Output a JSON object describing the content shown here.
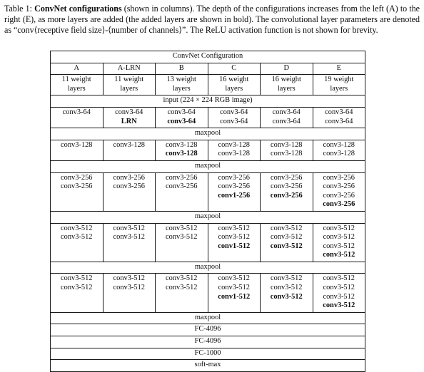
{
  "caption": {
    "label": "Table 1:",
    "bold_title": "ConvNet configurations",
    "text_rest": " (shown in columns). The depth of the configurations increases from the left (A) to the right (E), as more layers are added (the added layers are shown in bold). The convolutional layer parameters are denoted as “conv⟨receptive field size⟩-⟨number of channels⟩”. The ReLU activation function is not shown for brevity."
  },
  "table": {
    "title": "ConvNet Configuration",
    "columns": [
      "A",
      "A-LRN",
      "B",
      "C",
      "D",
      "E"
    ],
    "weight_layers": [
      "11 weight\nlayers",
      "11 weight\nlayers",
      "13 weight\nlayers",
      "16 weight\nlayers",
      "16 weight\nlayers",
      "19 weight\nlayers"
    ],
    "weight_layers_line1": [
      "11 weight",
      "11 weight",
      "13 weight",
      "16 weight",
      "16 weight",
      "19 weight"
    ],
    "weight_layers_line2": [
      "layers",
      "layers",
      "layers",
      "layers",
      "layers",
      "layers"
    ],
    "input_row": "input (224 × 224 RGB image)",
    "maxpool_label": "maxpool",
    "blocks": [
      {
        "name": "block-64",
        "cells": [
          [
            {
              "t": "conv3-64",
              "b": false
            }
          ],
          [
            {
              "t": "conv3-64",
              "b": false
            },
            {
              "t": "LRN",
              "b": true
            }
          ],
          [
            {
              "t": "conv3-64",
              "b": false
            },
            {
              "t": "conv3-64",
              "b": true
            }
          ],
          [
            {
              "t": "conv3-64",
              "b": false
            },
            {
              "t": "conv3-64",
              "b": false
            }
          ],
          [
            {
              "t": "conv3-64",
              "b": false
            },
            {
              "t": "conv3-64",
              "b": false
            }
          ],
          [
            {
              "t": "conv3-64",
              "b": false
            },
            {
              "t": "conv3-64",
              "b": false
            }
          ]
        ]
      },
      {
        "name": "block-128",
        "cells": [
          [
            {
              "t": "conv3-128",
              "b": false
            }
          ],
          [
            {
              "t": "conv3-128",
              "b": false
            }
          ],
          [
            {
              "t": "conv3-128",
              "b": false
            },
            {
              "t": "conv3-128",
              "b": true
            }
          ],
          [
            {
              "t": "conv3-128",
              "b": false
            },
            {
              "t": "conv3-128",
              "b": false
            }
          ],
          [
            {
              "t": "conv3-128",
              "b": false
            },
            {
              "t": "conv3-128",
              "b": false
            }
          ],
          [
            {
              "t": "conv3-128",
              "b": false
            },
            {
              "t": "conv3-128",
              "b": false
            }
          ]
        ]
      },
      {
        "name": "block-256",
        "cells": [
          [
            {
              "t": "conv3-256",
              "b": false
            },
            {
              "t": "conv3-256",
              "b": false
            }
          ],
          [
            {
              "t": "conv3-256",
              "b": false
            },
            {
              "t": "conv3-256",
              "b": false
            }
          ],
          [
            {
              "t": "conv3-256",
              "b": false
            },
            {
              "t": "conv3-256",
              "b": false
            }
          ],
          [
            {
              "t": "conv3-256",
              "b": false
            },
            {
              "t": "conv3-256",
              "b": false
            },
            {
              "t": "conv1-256",
              "b": true
            }
          ],
          [
            {
              "t": "conv3-256",
              "b": false
            },
            {
              "t": "conv3-256",
              "b": false
            },
            {
              "t": "conv3-256",
              "b": true
            }
          ],
          [
            {
              "t": "conv3-256",
              "b": false
            },
            {
              "t": "conv3-256",
              "b": false
            },
            {
              "t": "conv3-256",
              "b": false
            },
            {
              "t": "conv3-256",
              "b": true
            }
          ]
        ]
      },
      {
        "name": "block-512-a",
        "cells": [
          [
            {
              "t": "conv3-512",
              "b": false
            },
            {
              "t": "conv3-512",
              "b": false
            }
          ],
          [
            {
              "t": "conv3-512",
              "b": false
            },
            {
              "t": "conv3-512",
              "b": false
            }
          ],
          [
            {
              "t": "conv3-512",
              "b": false
            },
            {
              "t": "conv3-512",
              "b": false
            }
          ],
          [
            {
              "t": "conv3-512",
              "b": false
            },
            {
              "t": "conv3-512",
              "b": false
            },
            {
              "t": "conv1-512",
              "b": true
            }
          ],
          [
            {
              "t": "conv3-512",
              "b": false
            },
            {
              "t": "conv3-512",
              "b": false
            },
            {
              "t": "conv3-512",
              "b": true
            }
          ],
          [
            {
              "t": "conv3-512",
              "b": false
            },
            {
              "t": "conv3-512",
              "b": false
            },
            {
              "t": "conv3-512",
              "b": false
            },
            {
              "t": "conv3-512",
              "b": true
            }
          ]
        ]
      },
      {
        "name": "block-512-b",
        "cells": [
          [
            {
              "t": "conv3-512",
              "b": false
            },
            {
              "t": "conv3-512",
              "b": false
            }
          ],
          [
            {
              "t": "conv3-512",
              "b": false
            },
            {
              "t": "conv3-512",
              "b": false
            }
          ],
          [
            {
              "t": "conv3-512",
              "b": false
            },
            {
              "t": "conv3-512",
              "b": false
            }
          ],
          [
            {
              "t": "conv3-512",
              "b": false
            },
            {
              "t": "conv3-512",
              "b": false
            },
            {
              "t": "conv1-512",
              "b": true
            }
          ],
          [
            {
              "t": "conv3-512",
              "b": false
            },
            {
              "t": "conv3-512",
              "b": false
            },
            {
              "t": "conv3-512",
              "b": true
            }
          ],
          [
            {
              "t": "conv3-512",
              "b": false
            },
            {
              "t": "conv3-512",
              "b": false
            },
            {
              "t": "conv3-512",
              "b": false
            },
            {
              "t": "conv3-512",
              "b": true
            }
          ]
        ]
      }
    ],
    "footer_rows": [
      "maxpool",
      "FC-4096",
      "FC-4096",
      "FC-1000",
      "soft-max"
    ]
  }
}
